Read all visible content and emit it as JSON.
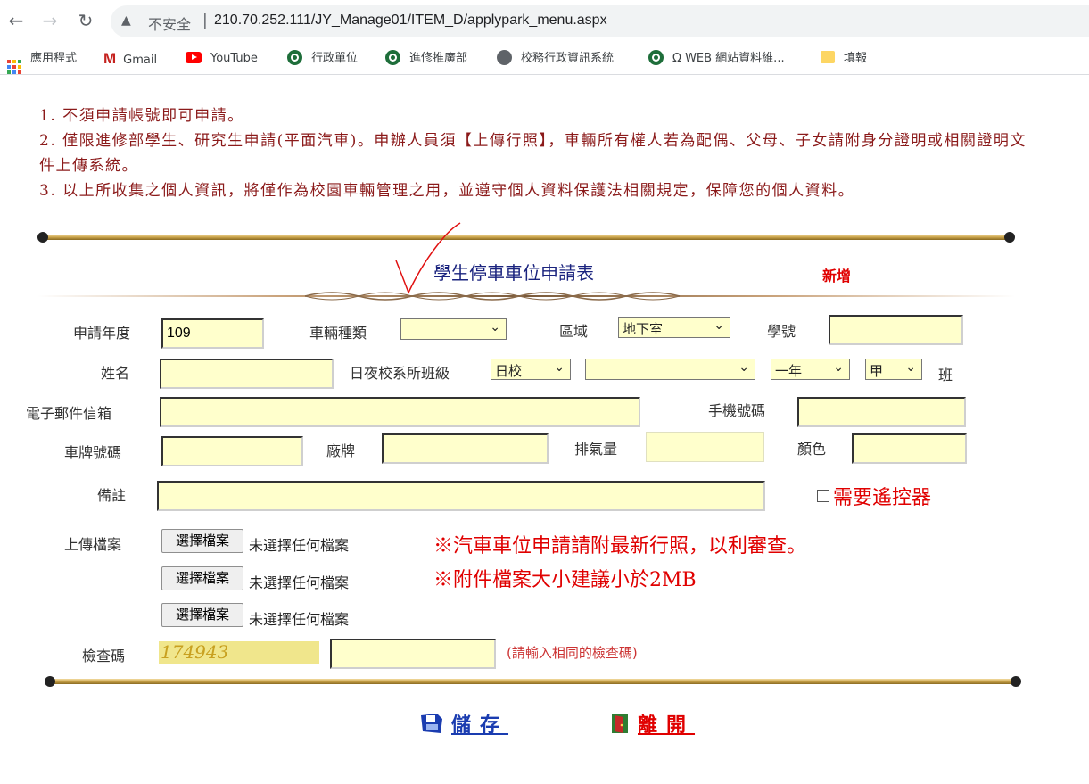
{
  "browser": {
    "security_label": "不安全",
    "url": "210.70.252.111/JY_Manage01/ITEM_D/applypark_menu.aspx",
    "bookmarks": [
      {
        "label": "應用程式",
        "icon": "apps-grid-icon"
      },
      {
        "label": "Gmail",
        "icon": "gmail-icon"
      },
      {
        "label": "YouTube",
        "icon": "youtube-icon"
      },
      {
        "label": "行政單位",
        "icon": "site-icon"
      },
      {
        "label": "進修推廣部",
        "icon": "site-icon"
      },
      {
        "label": "校務行政資訊系統",
        "icon": "globe-icon"
      },
      {
        "label": "Ω WEB 網站資料維...",
        "icon": "site-icon"
      },
      {
        "label": "填報",
        "icon": "folder-icon"
      }
    ]
  },
  "notes": [
    "1. 不須申請帳號即可申請。",
    "2. 僅限進修部學生、研究生申請(平面汽車)。申辦人員須【上傳行照】，車輛所有權人若為配偶、父母、子女請附身分證明或相關證明文件上傳系統。",
    "3. 以上所收集之個人資訊，將僅作為校園車輛管理之用，並遵守個人資料保護法相關規定，保障您的個人資料。"
  ],
  "form": {
    "title": "學生停車車位申請表",
    "mode_label": "新增",
    "labels": {
      "year": "申請年度",
      "vehicle_type": "車輛種類",
      "area": "區域",
      "student_id": "學號",
      "name": "姓名",
      "class_info": "日夜校系所班級",
      "class_suffix": "班",
      "email": "電子郵件信箱",
      "mobile": "手機號碼",
      "plate": "車牌號碼",
      "brand": "廠牌",
      "displacement": "排氣量",
      "color": "顏色",
      "remarks": "備註",
      "upload": "上傳檔案",
      "captcha": "檢查碼"
    },
    "values": {
      "year": "109",
      "vehicle_type": "",
      "area": "地下室",
      "school_type": "日校",
      "department": "",
      "grade": "一年",
      "class_section": "甲"
    },
    "remote_label": "需要遙控器",
    "file_button": "選擇檔案",
    "file_none": "未選擇任何檔案",
    "upload_notes": [
      "※汽車車位申請請附最新行照，以利審查。",
      "※附件檔案大小建議小於2MB"
    ],
    "captcha_code": "174943",
    "captcha_hint": "(請輸入相同的檢查碼)",
    "save_label": "儲存",
    "leave_label": "離開"
  }
}
